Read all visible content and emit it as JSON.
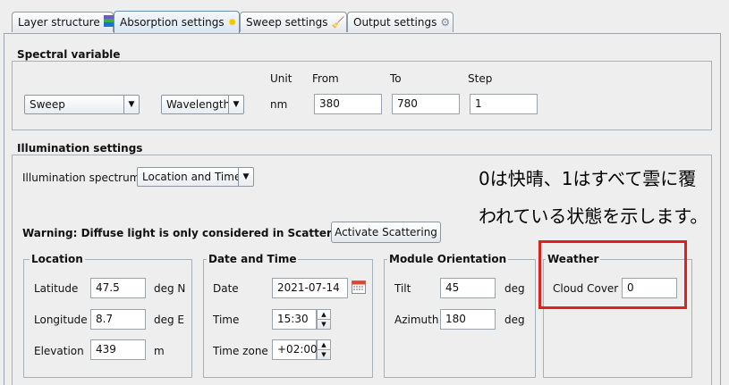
{
  "tabs": [
    {
      "label": "Layer structure",
      "icon": "layers-icon"
    },
    {
      "label": "Absorption settings",
      "icon": "sun-icon"
    },
    {
      "label": "Sweep settings",
      "icon": "broom-icon"
    },
    {
      "label": "Output settings",
      "icon": "output-icon"
    }
  ],
  "spectral": {
    "title": "Spectral variable",
    "mode": "Sweep",
    "variable": "Wavelength",
    "unit_header": "Unit",
    "from_header": "From",
    "to_header": "To",
    "step_header": "Step",
    "unit": "nm",
    "from": "380",
    "to": "780",
    "step": "1"
  },
  "illumination": {
    "title": "Illumination settings",
    "spectrum_label": "Illumination spectrum",
    "spectrum_value": "Location and Time",
    "warning": "Warning: Diffuse light is only considered in Scattering Mode",
    "activate_button": "Activate Scattering"
  },
  "annotation": {
    "line1": "0は快晴、1はすべて雲に覆",
    "line2": "われている状態を示します。",
    "highlight_color": "#e02020"
  },
  "location": {
    "title": "Location",
    "latitude_label": "Latitude",
    "latitude": "47.5",
    "latitude_unit": "deg N",
    "longitude_label": "Longitude",
    "longitude": "8.7",
    "longitude_unit": "deg E",
    "elevation_label": "Elevation",
    "elevation": "439",
    "elevation_unit": "m"
  },
  "datetime": {
    "title": "Date and Time",
    "date_label": "Date",
    "date": "2021-07-14",
    "time_label": "Time",
    "time": "15:30",
    "timezone_label": "Time zone",
    "timezone": "+02:00"
  },
  "orientation": {
    "title": "Module Orientation",
    "tilt_label": "Tilt",
    "tilt": "45",
    "tilt_unit": "deg",
    "azimuth_label": "Azimuth",
    "azimuth": "180",
    "azimuth_unit": "deg"
  },
  "weather": {
    "title": "Weather",
    "cloud_label": "Cloud Cover",
    "cloud": "0"
  }
}
